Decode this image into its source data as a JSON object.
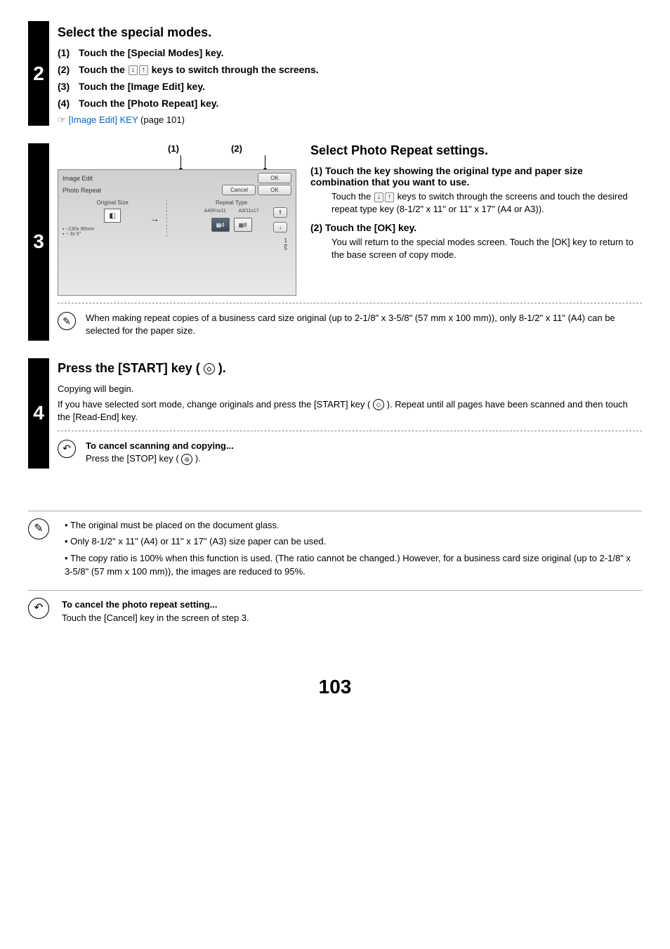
{
  "step2": {
    "number": "2",
    "title": "Select the special modes.",
    "items": [
      {
        "n": "(1)",
        "text": "Touch the [Special Modes] key."
      },
      {
        "n": "(2)",
        "text_a": "Touch the ",
        "text_b": " keys to switch through the screens."
      },
      {
        "n": "(3)",
        "text": "Touch the [Image Edit] key."
      },
      {
        "n": "(4)",
        "text": "Touch the [Photo Repeat] key."
      }
    ],
    "ref_link": "[Image Edit] KEY",
    "ref_tail": " (page 101)"
  },
  "step3": {
    "number": "3",
    "callout1": "(1)",
    "callout2": "(2)",
    "panel": {
      "image_edit": "Image Edit",
      "photo_repeat": "Photo Repeat",
      "cancel": "Cancel",
      "ok": "OK",
      "ok_top": "OK",
      "original_size": "Original Size",
      "repeat_type": "Repeat Type",
      "size1": "~130x 90mm",
      "size2": "~ 3x 5\"",
      "rep1": "A4/8½x11",
      "rep2": "A3/11x17",
      "rep_n1": "4",
      "rep_n2": "8",
      "page_cur": "1",
      "page_total": "5"
    },
    "explain_title": "Select Photo Repeat settings.",
    "e1_head": "(1)  Touch the key showing the original type and paper size combination that you want to use.",
    "e1_body_a": "Touch the ",
    "e1_body_b": " keys to switch through the screens and touch the desired repeat type key (8-1/2\" x 11\" or 11\" x 17\" (A4 or A3)).",
    "e2_head": "(2)  Touch the [OK] key.",
    "e2_body": "You will return to the special modes screen. Touch the [OK] key to return to the base screen of copy mode.",
    "note": "When making repeat copies of a business card size original (up to 2-1/8\" x 3-5/8\" (57 mm x 100 mm)), only 8-1/2\" x 11\" (A4) can be selected for the paper size."
  },
  "step4": {
    "number": "4",
    "title_a": "Press the [START] key ( ",
    "title_b": " ).",
    "line1": "Copying will begin.",
    "line2_a": "If you have selected sort mode, change originals and press the [START] key ( ",
    "line2_b": " ). Repeat until all pages have been scanned and then touch the [Read-End] key.",
    "cancel_head": "To cancel scanning and copying...",
    "cancel_body_a": "Press the [STOP] key ( ",
    "cancel_body_b": " )."
  },
  "bottom": {
    "bullets": [
      "The original must be placed on the document glass.",
      "Only 8-1/2\" x 11\" (A4) or 11\" x 17\" (A3) size paper can be used.",
      "The copy ratio is 100% when this function is used. (The ratio cannot be changed.) However, for a business card size original (up to 2-1/8\" x 3-5/8\" (57 mm x 100 mm)), the images are reduced to 95%."
    ],
    "cancel_head": "To cancel the photo repeat setting...",
    "cancel_body": "Touch the [Cancel] key in the screen of step 3."
  },
  "page_number": "103"
}
